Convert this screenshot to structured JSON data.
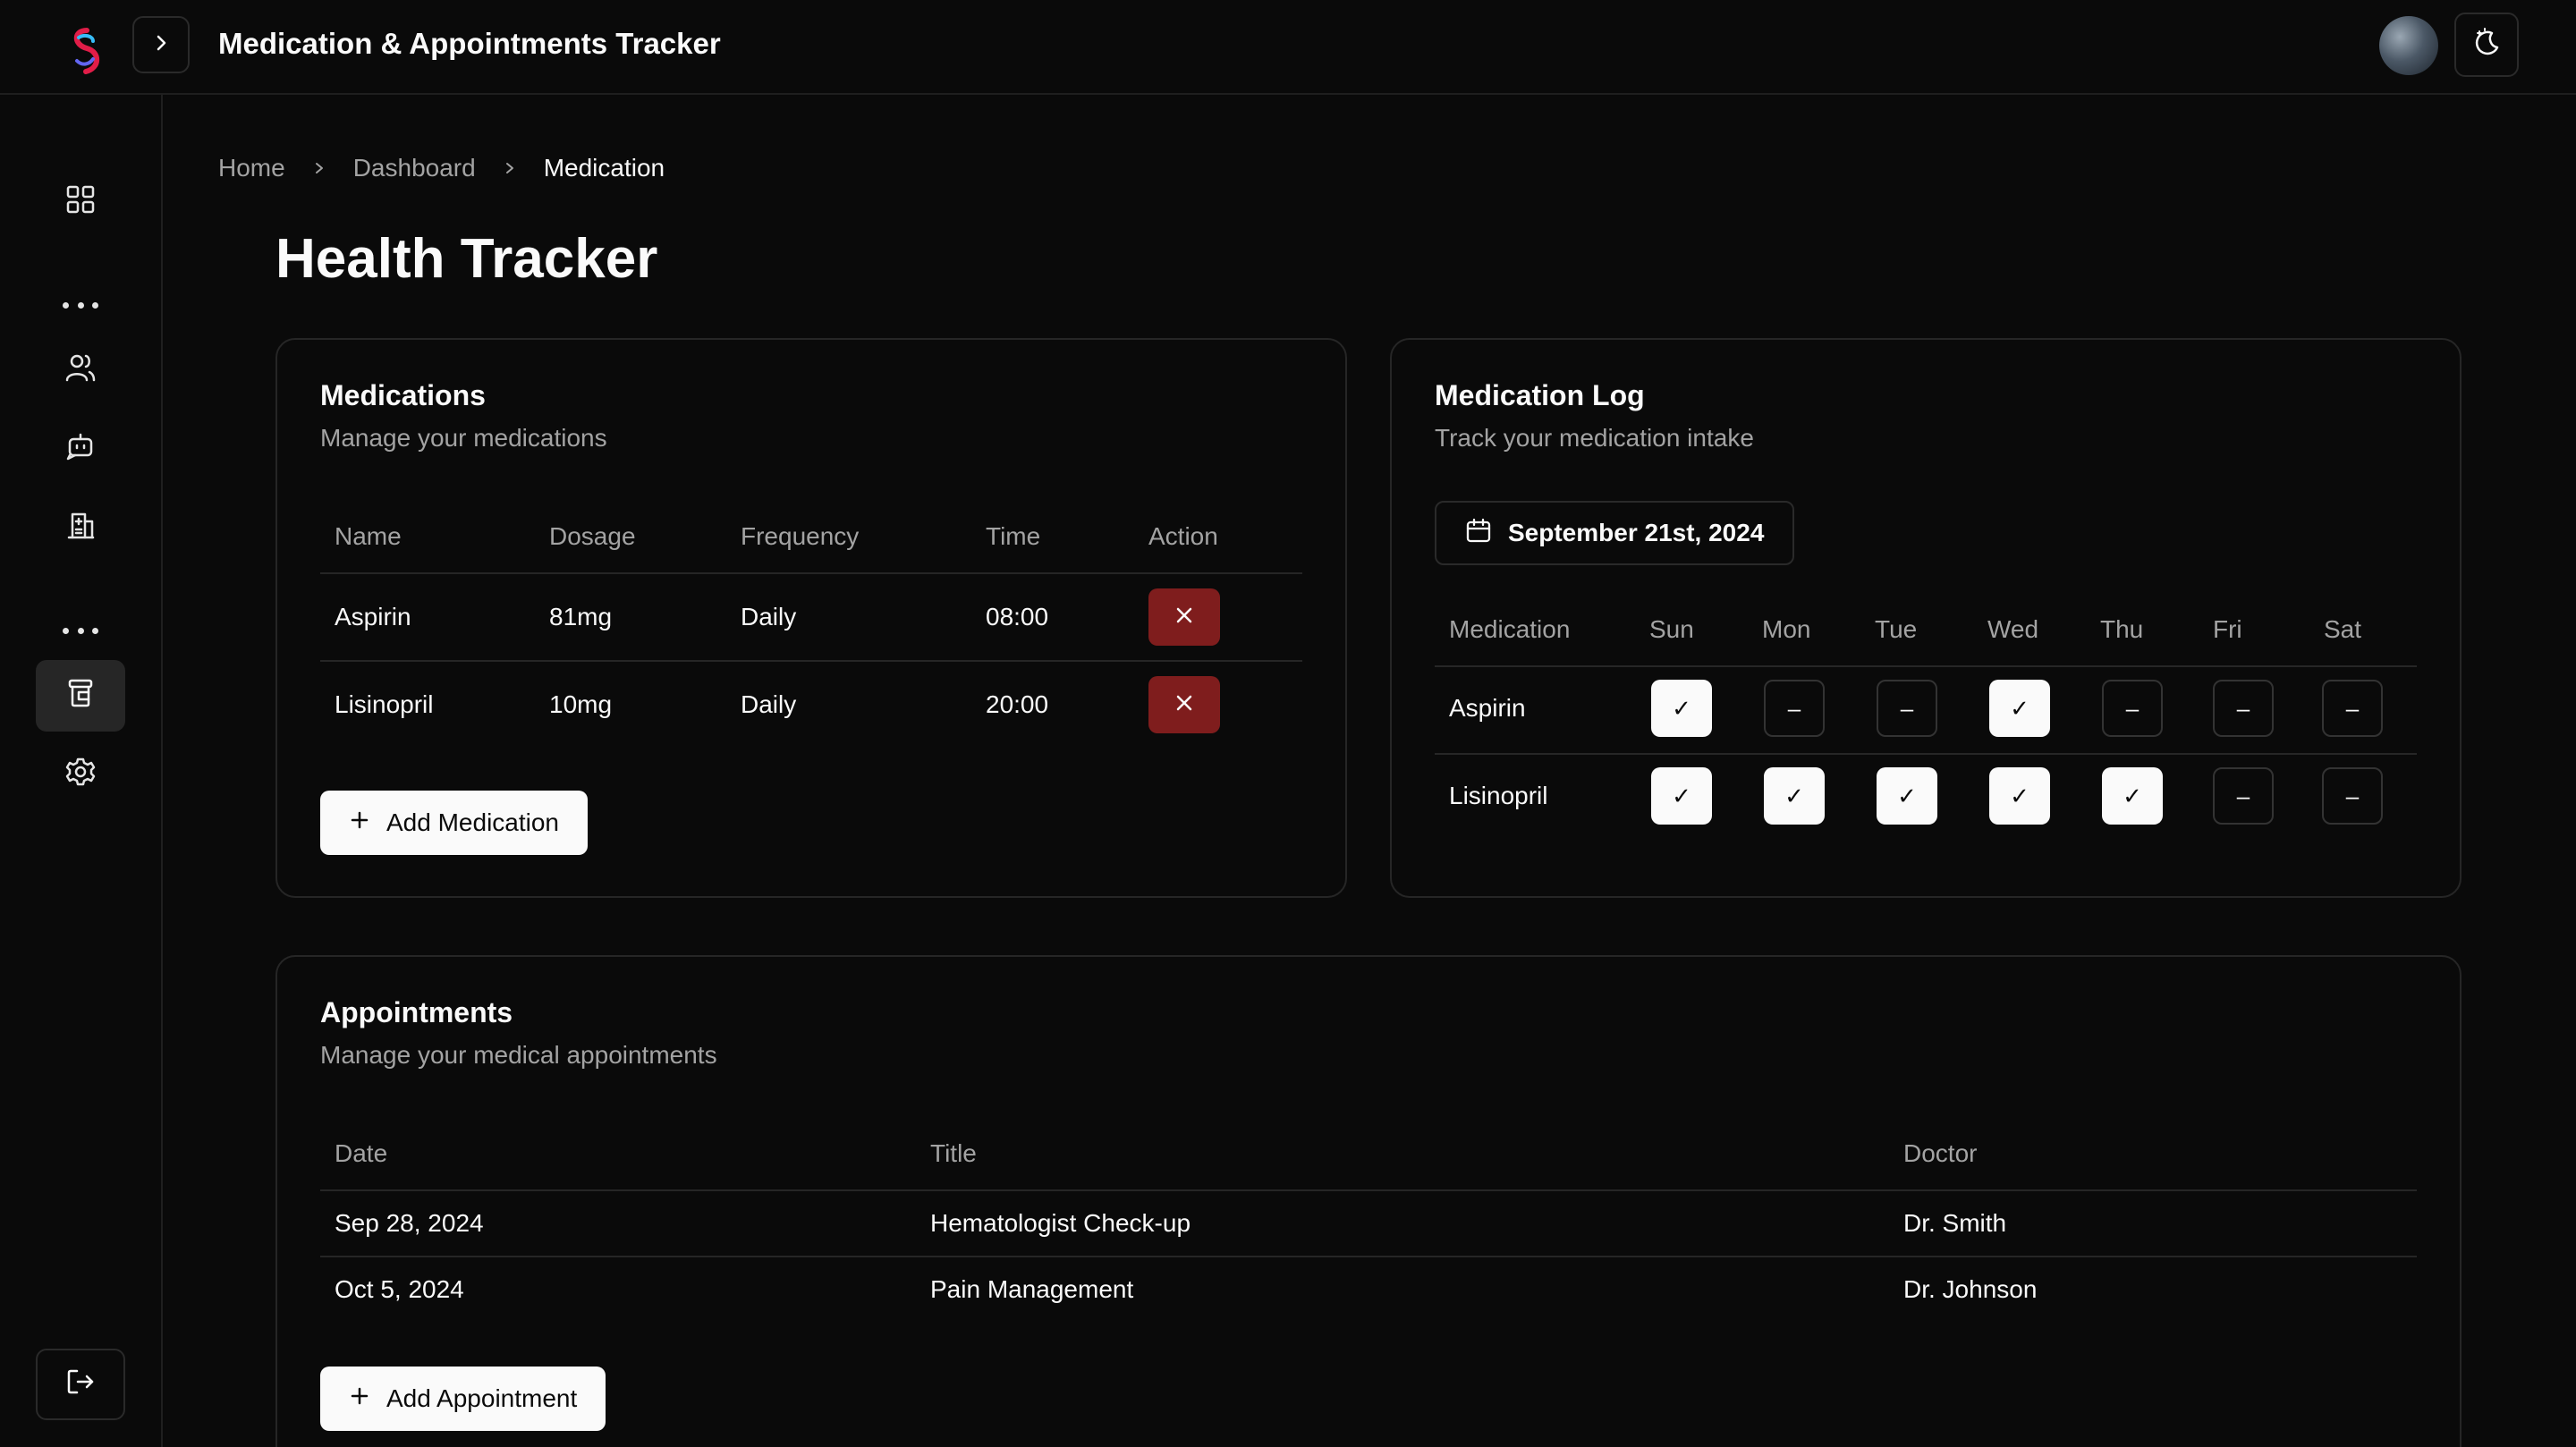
{
  "header": {
    "title": "Medication & Appointments Tracker"
  },
  "breadcrumb": {
    "home": "Home",
    "dashboard": "Dashboard",
    "current": "Medication"
  },
  "page": {
    "title": "Health Tracker"
  },
  "medications": {
    "title": "Medications",
    "description": "Manage your medications",
    "columns": [
      "Name",
      "Dosage",
      "Frequency",
      "Time",
      "Action"
    ],
    "rows": [
      {
        "name": "Aspirin",
        "dosage": "81mg",
        "frequency": "Daily",
        "time": "08:00"
      },
      {
        "name": "Lisinopril",
        "dosage": "10mg",
        "frequency": "Daily",
        "time": "20:00"
      }
    ],
    "add_label": "Add Medication"
  },
  "log": {
    "title": "Medication Log",
    "description": "Track your medication intake",
    "date": "September 21st, 2024",
    "columns": [
      "Medication",
      "Sun",
      "Mon",
      "Tue",
      "Wed",
      "Thu",
      "Fri",
      "Sat"
    ],
    "rows": [
      {
        "name": "Aspirin",
        "days": [
          "✓",
          "–",
          "–",
          "✓",
          "–",
          "–",
          "–"
        ],
        "taken": [
          true,
          false,
          false,
          true,
          false,
          false,
          false
        ]
      },
      {
        "name": "Lisinopril",
        "days": [
          "✓",
          "✓",
          "✓",
          "✓",
          "✓",
          "–",
          "–"
        ],
        "taken": [
          true,
          true,
          true,
          true,
          true,
          false,
          false
        ]
      }
    ]
  },
  "appointments": {
    "title": "Appointments",
    "description": "Manage your medical appointments",
    "columns": [
      "Date",
      "Title",
      "Doctor"
    ],
    "rows": [
      {
        "date": "Sep 28, 2024",
        "title": "Hematologist Check-up",
        "doctor": "Dr. Smith"
      },
      {
        "date": "Oct 5, 2024",
        "title": "Pain Management",
        "doctor": "Dr. Johnson"
      }
    ],
    "add_label": "Add Appointment"
  },
  "colors": {
    "background": "#0a0a0a",
    "danger": "#7f1d1d",
    "border": "#262626",
    "muted_text": "#a3a3a3"
  },
  "icons": [
    "logo-icon",
    "chevron-right-icon",
    "moon-icon",
    "grid-icon",
    "users-icon",
    "bot-icon",
    "hospital-icon",
    "pill-bottle-icon",
    "gear-icon",
    "logout-icon",
    "x-icon",
    "plus-icon",
    "calendar-icon"
  ]
}
